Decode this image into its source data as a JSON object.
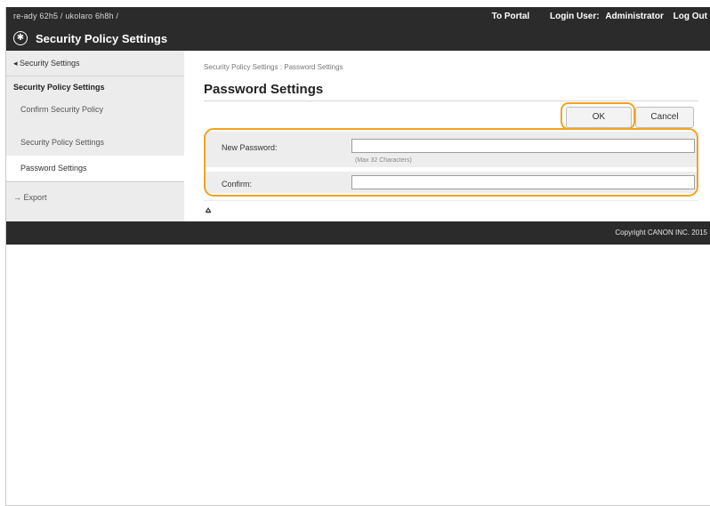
{
  "topbar": {
    "device": "re-ady 62h5 / ukolaro 6h8h /",
    "to_portal": "To Portal",
    "login_label": "Login User:",
    "login_user": "Administrator",
    "logout": "Log Out"
  },
  "header": {
    "title": "Security Policy Settings",
    "icon": "lock-gear-icon"
  },
  "sidebar": {
    "back": "◂ Security Settings",
    "group": "Security Policy Settings",
    "items": [
      {
        "label": "Confirm Security Policy",
        "active": false
      },
      {
        "label": "Security Policy Settings",
        "active": false
      },
      {
        "label": "Password Settings",
        "active": true
      }
    ],
    "export": "→ Export"
  },
  "main": {
    "breadcrumb": "Security Policy Settings : Password Settings",
    "title": "Password Settings",
    "ok_label": "OK",
    "cancel_label": "Cancel",
    "form": {
      "new_password_label": "New Password:",
      "new_password_value": "",
      "hint": "(Max 32 Characters)",
      "confirm_label": "Confirm:",
      "confirm_value": ""
    },
    "to_top": "⩟"
  },
  "footer": {
    "copyright": "Copyright CANON INC. 2015"
  },
  "colors": {
    "bar": "#2b2b2b",
    "highlight": "#f3a31f",
    "sidebar_bg": "#ececec",
    "form_bg": "#ededed"
  }
}
